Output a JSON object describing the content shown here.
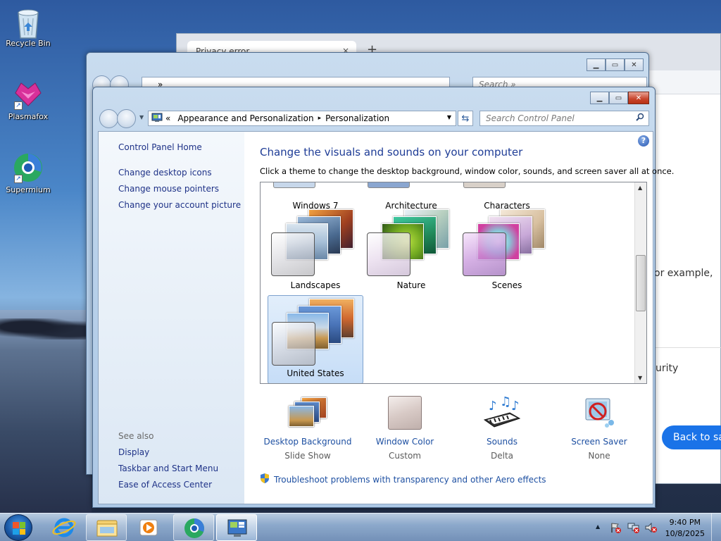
{
  "desktop": {
    "icons": [
      {
        "label": "Recycle Bin"
      },
      {
        "label": "Plasmafox"
      },
      {
        "label": "Supermium"
      }
    ]
  },
  "browser": {
    "tab_title": "Privacy error",
    "new_tab": "+",
    "tab_close": "×",
    "text_example": "or example,",
    "text_security": "urity",
    "back_button": "Back to safe"
  },
  "behind_window": {
    "path": "»",
    "search_placeholder": "Search »"
  },
  "window": {
    "breadcrumb": {
      "overflow": "«",
      "items": [
        "Appearance and Personalization",
        "Personalization"
      ],
      "separator": "▸"
    },
    "search_placeholder": "Search Control Panel",
    "sidebar": {
      "home": "Control Panel Home",
      "links": [
        "Change desktop icons",
        "Change mouse pointers",
        "Change your account picture"
      ],
      "see_also_label": "See also",
      "see_also": [
        "Display",
        "Taskbar and Start Menu",
        "Ease of Access Center"
      ]
    },
    "heading": "Change the visuals and sounds on your computer",
    "description": "Click a theme to change the desktop background, window color, sounds, and screen saver all at once.",
    "themes_top_row": [
      "Windows 7",
      "Architecture",
      "Characters"
    ],
    "themes": [
      {
        "name": "Landscapes",
        "selected": false
      },
      {
        "name": "Nature",
        "selected": false
      },
      {
        "name": "Scenes",
        "selected": false
      },
      {
        "name": "United States",
        "selected": true
      }
    ],
    "bottom": [
      {
        "title": "Desktop Background",
        "value": "Slide Show"
      },
      {
        "title": "Window Color",
        "value": "Custom"
      },
      {
        "title": "Sounds",
        "value": "Delta"
      },
      {
        "title": "Screen Saver",
        "value": "None"
      }
    ],
    "troubleshoot": "Troubleshoot problems with transparency and other Aero effects",
    "help": "?"
  },
  "taskbar": {
    "time": "9:40 PM",
    "date": "10/8/2025",
    "tray_arrow": "▲"
  }
}
